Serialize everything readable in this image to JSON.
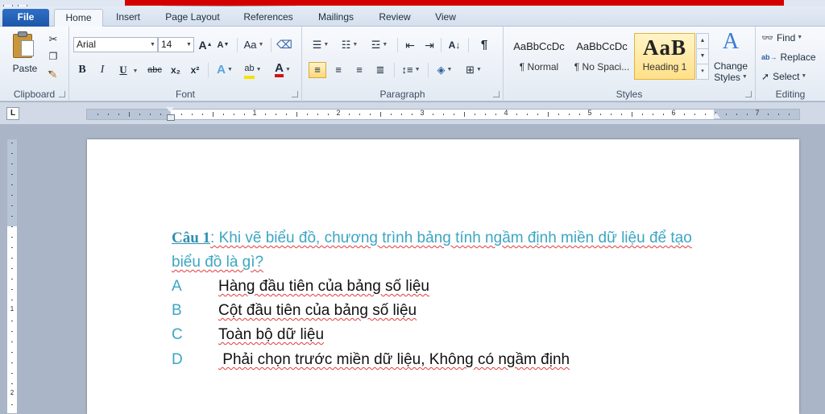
{
  "tabs": [
    "File",
    "Home",
    "Insert",
    "Page Layout",
    "References",
    "Mailings",
    "Review",
    "View"
  ],
  "ribbon": {
    "clipboard": {
      "paste_label": "Paste",
      "group_label": "Clipboard"
    },
    "font": {
      "font_name": "Arial",
      "font_size": "14",
      "group_label": "Font",
      "grow_label": "A",
      "shrink_label": "A",
      "case_label": "Aa",
      "bold": "B",
      "italic": "I",
      "underline": "U",
      "strike": "abc",
      "subscript": "x₂",
      "superscript": "x²",
      "text_effects": "A",
      "highlight": "ab",
      "font_color": "A"
    },
    "paragraph": {
      "group_label": "Paragraph",
      "pilcrow": "¶"
    },
    "styles": {
      "group_label": "Styles",
      "items": [
        {
          "sample": "AaBbCcDc",
          "name": "¶ Normal"
        },
        {
          "sample": "AaBbCcDc",
          "name": "¶ No Spaci..."
        },
        {
          "sample": "AaB",
          "name": "Heading 1"
        }
      ],
      "change_styles_line1": "Change",
      "change_styles_line2": "Styles"
    },
    "editing": {
      "group_label": "Editing",
      "find": "Find",
      "replace": "Replace",
      "select": "Select"
    }
  },
  "ruler": {
    "tab_selector": "L",
    "numbers": [
      "1",
      "2",
      "3",
      "4",
      "5",
      "6",
      "7"
    ],
    "vnumbers": [
      "1",
      "2"
    ]
  },
  "document": {
    "question_label": "Câu 1",
    "question_text": ": Khi vẽ biểu đồ, chương trình bảng tính ngầm định miền dữ liệu để tạo biểu đồ là gì?",
    "answers": [
      {
        "letter": "A",
        "text": "Hàng đầu tiên của bảng số liệu"
      },
      {
        "letter": "B",
        "text": "Cột đầu tiên của bảng số liệu"
      },
      {
        "letter": "C",
        "text": "Toàn bộ dữ liệu"
      },
      {
        "letter": "D",
        "text": " Phải chọn trước miền dữ liệu, Không có ngầm định"
      }
    ]
  },
  "colors": {
    "accent_text": "#3ba6c4",
    "banner_red": "#d40000",
    "file_tab": "#1c57a8",
    "selected_style": "#ffe089"
  }
}
